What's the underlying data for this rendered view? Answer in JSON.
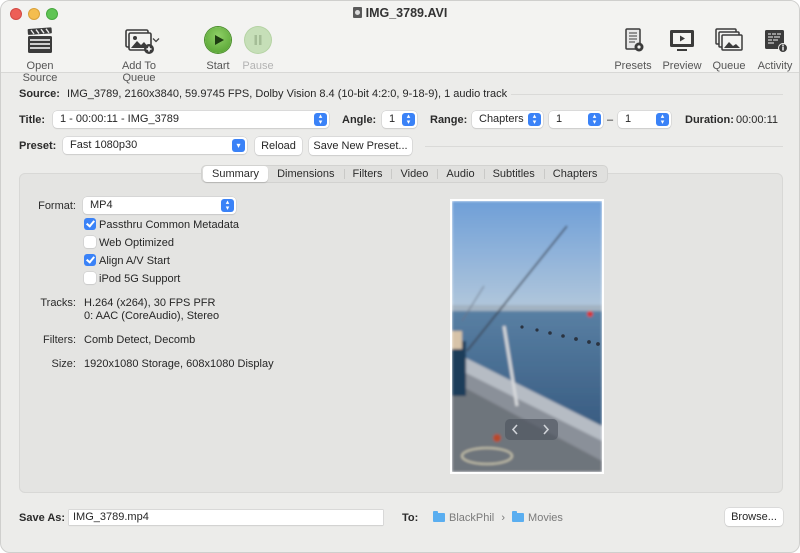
{
  "window": {
    "title": "IMG_3789.AVI",
    "doc_icon": "video-document-icon"
  },
  "toolbar": {
    "open_source": {
      "label": "Open Source",
      "icon": "clapperboard-icon"
    },
    "add_to_queue": {
      "label": "Add To Queue",
      "icon": "add-photos-icon",
      "dropdown": "chevron-down-icon"
    },
    "start": {
      "label": "Start",
      "icon": "play-icon"
    },
    "pause": {
      "label": "Pause",
      "icon": "pause-icon",
      "enabled": false
    },
    "presets": {
      "label": "Presets",
      "icon": "presets-gear-icon"
    },
    "preview": {
      "label": "Preview",
      "icon": "monitor-play-icon"
    },
    "queue": {
      "label": "Queue",
      "icon": "stacked-photos-icon"
    },
    "activity": {
      "label": "Activity",
      "icon": "activity-log-icon"
    }
  },
  "source": {
    "label": "Source:",
    "value": "IMG_3789, 2160x3840, 59.9745 FPS, Dolby Vision 8.4 (10-bit 4:2:0, 9-18-9), 1 audio track"
  },
  "title_row": {
    "title_label": "Title:",
    "title_value": "1 - 00:00:11 - IMG_3789",
    "angle_label": "Angle:",
    "angle_value": "1",
    "range_label": "Range:",
    "range_type": "Chapters",
    "range_start": "1",
    "range_dash": "–",
    "range_end": "1",
    "duration_label": "Duration:",
    "duration_value": "00:00:11"
  },
  "preset_row": {
    "label": "Preset:",
    "value": "Fast 1080p30",
    "reload_label": "Reload",
    "save_new_label": "Save New Preset..."
  },
  "tabs": [
    {
      "label": "Summary",
      "active": true
    },
    {
      "label": "Dimensions",
      "active": false
    },
    {
      "label": "Filters",
      "active": false
    },
    {
      "label": "Video",
      "active": false
    },
    {
      "label": "Audio",
      "active": false
    },
    {
      "label": "Subtitles",
      "active": false
    },
    {
      "label": "Chapters",
      "active": false
    }
  ],
  "summary": {
    "format_label": "Format:",
    "format_value": "MP4",
    "options": [
      {
        "label": "Passthru Common Metadata",
        "checked": true
      },
      {
        "label": "Web Optimized",
        "checked": false
      },
      {
        "label": "Align A/V Start",
        "checked": true
      },
      {
        "label": "iPod 5G Support",
        "checked": false
      }
    ],
    "tracks_label": "Tracks:",
    "tracks_lines": [
      "H.264 (x264), 30 FPS PFR",
      "0: AAC (CoreAudio), Stereo"
    ],
    "filters_label": "Filters:",
    "filters_value": "Comb Detect, Decomb",
    "size_label": "Size:",
    "size_value": "1920x1080 Storage, 608x1080 Display"
  },
  "preview": {
    "prev_icon": "chevron-left-icon",
    "next_icon": "chevron-right-icon"
  },
  "footer": {
    "save_as_label": "Save As:",
    "save_as_value": "IMG_3789.mp4",
    "to_label": "To:",
    "path": [
      "BlackPhil",
      "Movies"
    ],
    "path_separator": "›",
    "browse_label": "Browse..."
  },
  "colors": {
    "accent": "#3a82f7",
    "start_green": "#5cb335",
    "close": "#ed5f57",
    "minimize": "#f4bd4f",
    "maximize": "#5fc454"
  }
}
